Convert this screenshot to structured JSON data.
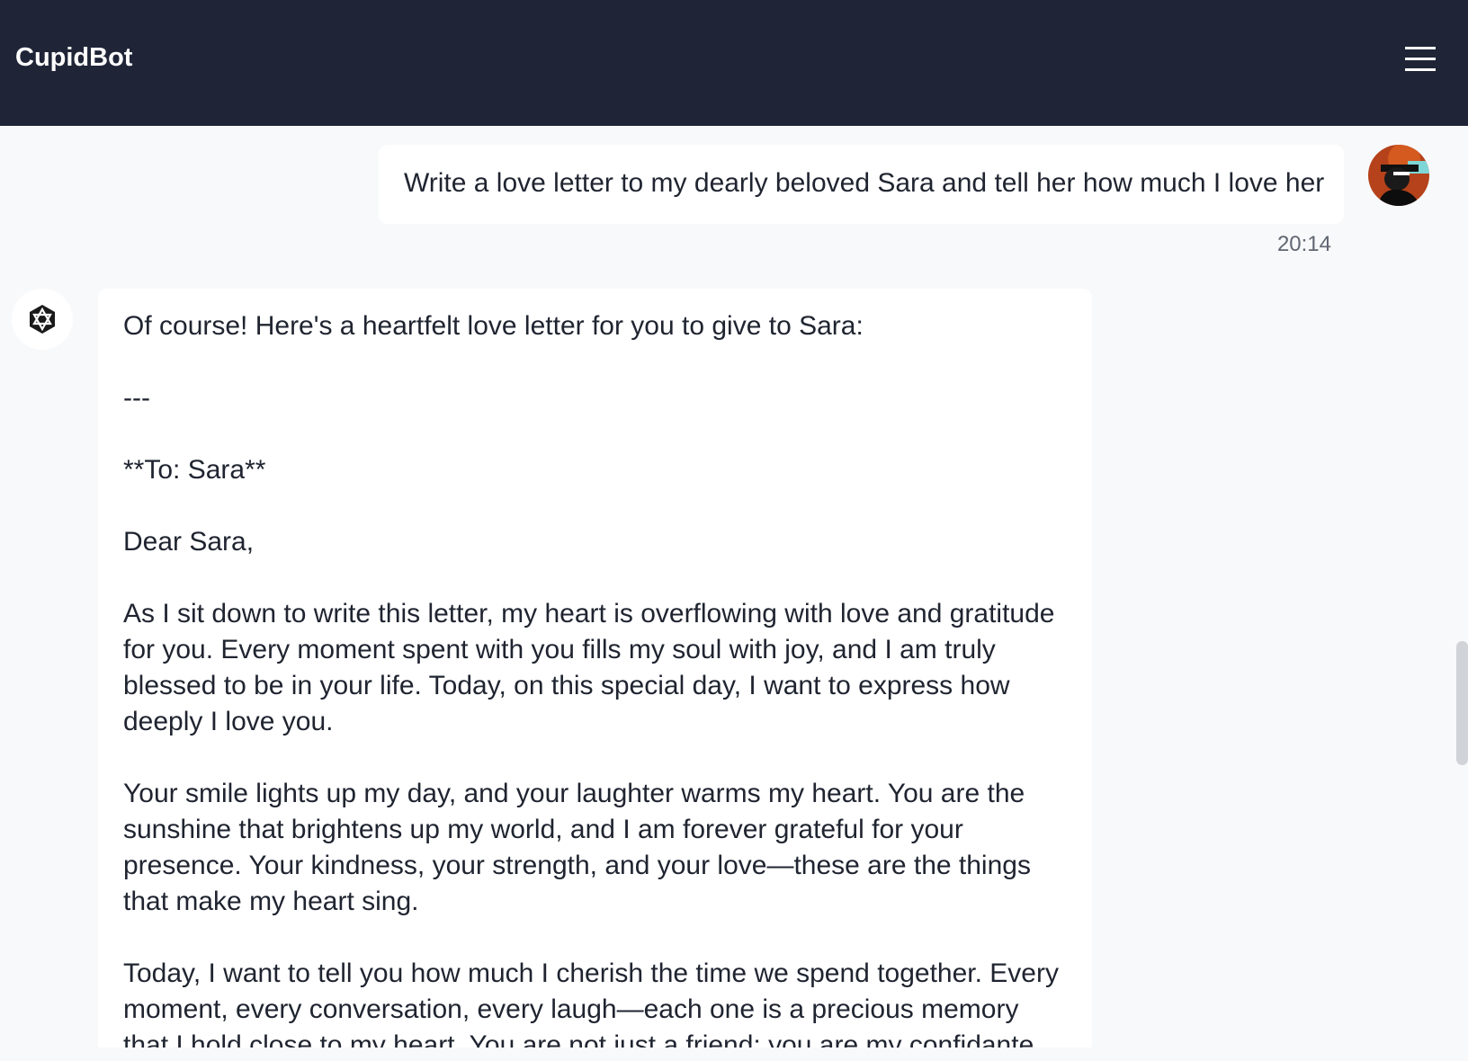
{
  "header": {
    "title": "CupidBot",
    "menu_icon": "hamburger-menu-icon"
  },
  "messages": {
    "user": {
      "text": "Write a love letter to my dearly beloved Sara and tell her how much I love her",
      "time": "20:14",
      "avatar_icon": "user-avatar"
    },
    "bot": {
      "avatar_icon": "bot-logo-icon",
      "paragraphs": [
        "Of course! Here's a heartfelt love letter for you to give to Sara:",
        "---",
        "**To: Sara**",
        "Dear Sara,",
        "As I sit down to write this letter, my heart is overflowing with love and gratitude for you. Every moment spent with you fills my soul with joy, and I am truly blessed to be in your life. Today, on this special day, I want to express how deeply I love you.",
        "Your smile lights up my day, and your laughter warms my heart. You are the sunshine that brightens up my world, and I am forever grateful for your presence. Your kindness, your strength, and your love—these are the things that make my heart sing.",
        "Today, I want to tell you how much I cherish the time we spend together. Every moment, every conversation, every laugh—each one is a precious memory that I hold close to my heart. You are not just a friend; you are my confidante"
      ]
    }
  },
  "colors": {
    "header_bg": "#1f2537",
    "page_bg": "#f8f9fa",
    "bubble_bg": "#ffffff"
  }
}
